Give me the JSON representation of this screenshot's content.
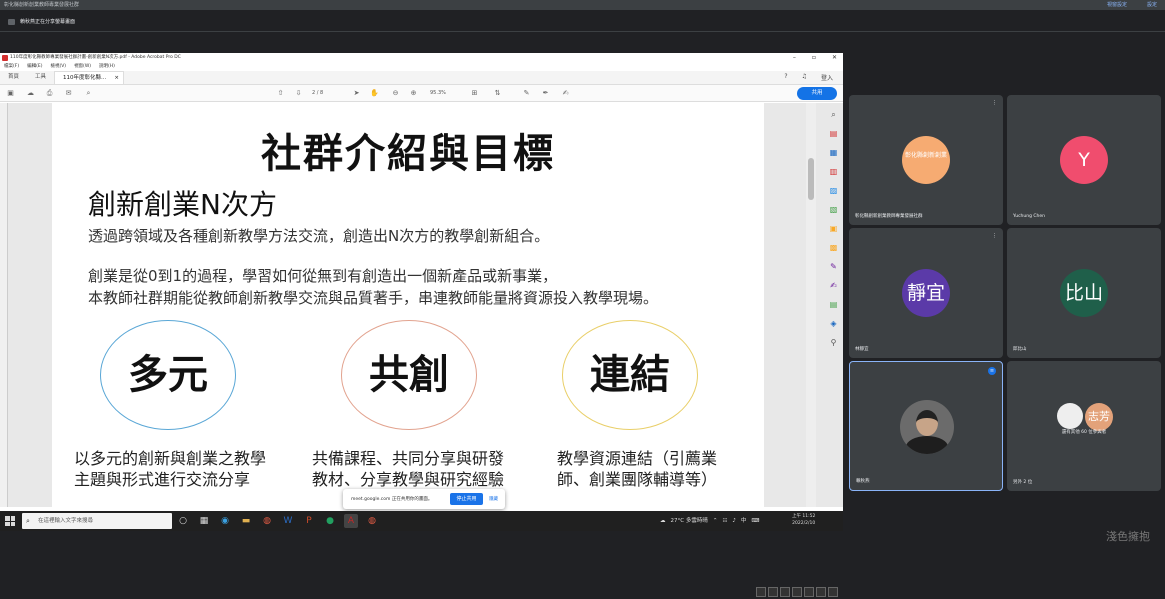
{
  "meet": {
    "top_title": "彰化縣創新創業教師專業發展社群",
    "top_right_1": "視窗設定",
    "top_right_2": "設定",
    "presenting_label": "賴秋燕正在分享螢幕畫面"
  },
  "acrobat": {
    "title": "110年度彰化縣教師專業發展社群計畫-創新創業N次方.pdf - Adobe Acrobat Pro DC",
    "menu": [
      "檔案(F)",
      "編輯(E)",
      "檢視(V)",
      "視窗(W)",
      "說明(H)"
    ],
    "tabs": [
      "首頁",
      "工具"
    ],
    "active_tab": "110年度彰化縣...",
    "login": "登入",
    "page": "2 / 8",
    "zoom": "95.3%",
    "share": "共用"
  },
  "slide": {
    "title": "社群介紹與目標",
    "subtitle": "創新創業N次方",
    "p1": "透過跨領域及各種創新教學方法交流，創造出N次方的教學創新組合。",
    "p2a": "創業是從0到1的過程，學習如何從無到有創造出一個新產品或新事業，",
    "p2b": "本教師社群期能從教師創新教學交流與品質著手，串連教師能量將資源投入教學現場。",
    "circles": [
      "多元",
      "共創",
      "連結"
    ],
    "d1a": "以多元的創新與創業之教學",
    "d1b": "主題與形式進行交流分享",
    "d2a": "共備課程、共同分享與研發",
    "d2b": "教材、分享教學與研究經驗",
    "d3a": "教學資源連結（引薦業",
    "d3b": "師、創業團隊輔導等）"
  },
  "share_notice": {
    "text": "meet.google.com 正在共用你的畫面。",
    "stop": "停止共用",
    "hide": "隱藏"
  },
  "taskbar": {
    "search_placeholder": "在這裡輸入文字來搜尋",
    "weather": "27°C 多雲時晴",
    "ime": "中",
    "time": "上午 11:52",
    "date": "2022/2/10"
  },
  "participants": [
    {
      "name": "彰化縣創新創業教師專業發展社群",
      "initials": "彰化縣創新創業"
    },
    {
      "name": "Yuchung Chen",
      "initials": "Y"
    },
    {
      "name": "林靜宜",
      "initials": "靜宜"
    },
    {
      "name": "邱比山",
      "initials": "比山"
    },
    {
      "name": "賴秋燕"
    },
    {
      "name": "另外 2 位",
      "extra": "還有其他 60 位參與者",
      "initials": "志芳"
    }
  ],
  "watermark": "淺色擁抱",
  "colors": {
    "meet_bg": "#202124",
    "tile_bg": "#3c4043",
    "acrobat_blue": "#1473e6"
  }
}
